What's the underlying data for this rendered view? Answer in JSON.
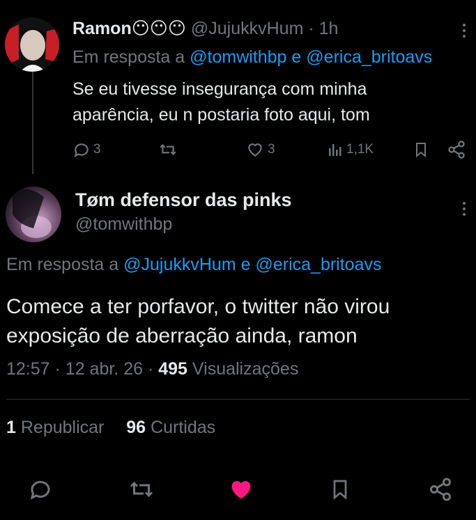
{
  "reply_tweet": {
    "display_name": "Ramon😶😶😶",
    "handle": "@JujukkvHum",
    "time": "· 1h",
    "reply_prefix": "Em resposta a",
    "reply_to_1": "@tomwithbp",
    "reply_conj": "e",
    "reply_to_2": "@erica_britoavs",
    "text": "Se eu tivesse insegurança com minha aparência, eu n postaria foto aqui, tom",
    "replies": "3",
    "likes": "3",
    "views": "1,1K"
  },
  "main_tweet": {
    "display_name": "Tøm defensor das pinks",
    "handle": "@tomwithbp",
    "reply_prefix": "Em resposta a",
    "reply_to_1": "@JujukkvHum",
    "reply_conj": "e",
    "reply_to_2": "@erica_britoavs",
    "text": "Comece a ter porfavor, o twitter não virou exposição de aberração ainda, ramon",
    "time": "12:57",
    "date": "12 abr. 26",
    "views_count": "495",
    "views_label": "Visualizações",
    "reposts_count": "1",
    "reposts_label": "Republicar",
    "likes_count": "96",
    "likes_label": "Curtidas"
  },
  "colors": {
    "background": "#000000",
    "text": "#e7e9ea",
    "secondary": "#71767b",
    "link": "#1d9bf0",
    "like_active": "#f91880",
    "divider": "#2f3336"
  },
  "icons": {
    "reply": "reply-icon",
    "repost": "repost-icon",
    "like": "heart-icon",
    "views": "views-icon",
    "bookmark": "bookmark-icon",
    "share": "share-icon",
    "more": "more-icon"
  }
}
